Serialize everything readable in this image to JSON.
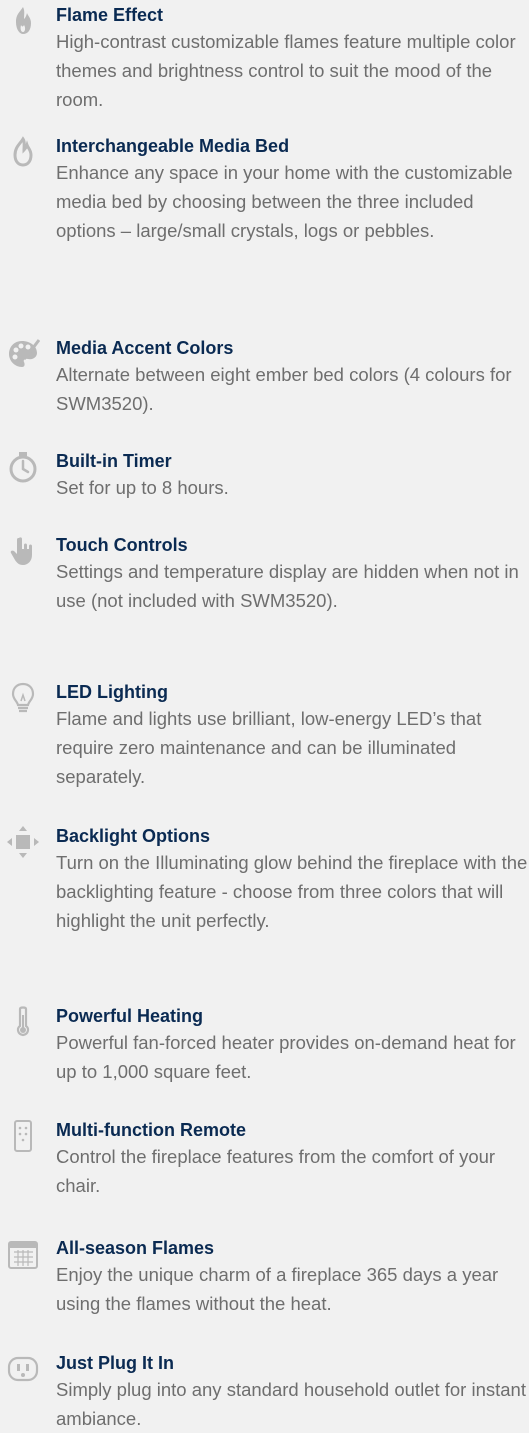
{
  "features": [
    {
      "icon": "flame-icon",
      "title": "Flame Effect",
      "description": "High-contrast customizable flames feature multiple color themes and brightness control to suit the mood of the room."
    },
    {
      "icon": "media-bed-flame-icon",
      "title": "Interchangeable Media Bed",
      "description": "Enhance any space in your home with the customizable media bed by choosing between the three included options – large/small crystals, logs or pebbles."
    },
    {
      "icon": "palette-icon",
      "title": "Media Accent Colors",
      "description": "Alternate between eight ember bed colors (4 colours for SWM3520)."
    },
    {
      "icon": "timer-icon",
      "title": "Built-in Timer",
      "description": "Set for up to 8 hours."
    },
    {
      "icon": "touch-hand-icon",
      "title": "Touch Controls",
      "description": "Settings and temperature display are hidden when not in use (not included with SWM3520)."
    },
    {
      "icon": "light-bulb-icon",
      "title": "LED Lighting",
      "description": "Flame and lights use brilliant, low-energy LED’s that require zero maintenance and can be illuminated separately."
    },
    {
      "icon": "backlight-icon",
      "title": "Backlight Options",
      "description": "Turn on the Illuminating glow behind the fireplace with the backlighting feature - choose from three colors that will highlight the unit perfectly."
    },
    {
      "icon": "thermometer-icon",
      "title": "Powerful Heating",
      "description": "Powerful fan-forced heater provides on-demand heat for up to 1,000 square feet."
    },
    {
      "icon": "remote-control-icon",
      "title": "Multi-function Remote",
      "description": "Control the fireplace features from the comfort of your chair."
    },
    {
      "icon": "calendar-icon",
      "title": "All-season Flames",
      "description": "Enjoy the unique charm of a fireplace 365 days a year using the flames without the heat."
    },
    {
      "icon": "outlet-plug-icon",
      "title": "Just Plug It In",
      "description": "Simply plug into any standard household outlet for instant ambiance."
    }
  ]
}
